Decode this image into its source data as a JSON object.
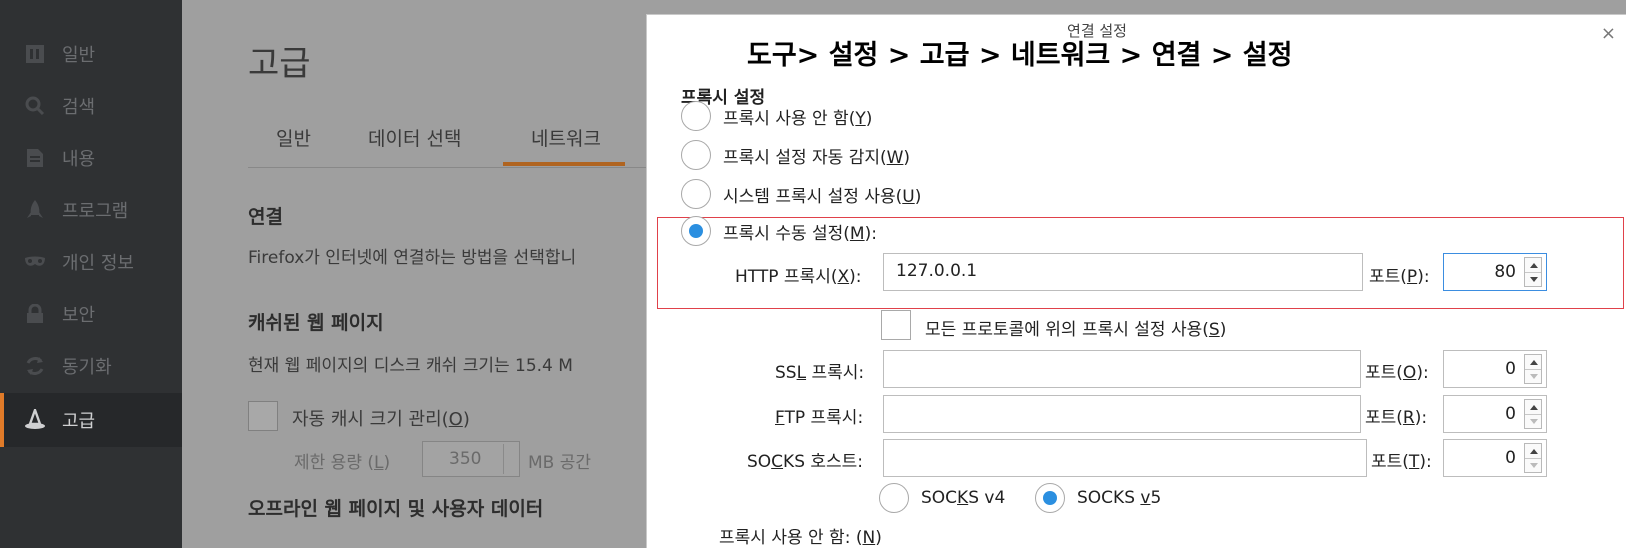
{
  "sidebar": {
    "items": [
      {
        "label": "일반",
        "icon": "general-icon"
      },
      {
        "label": "검색",
        "icon": "search-icon"
      },
      {
        "label": "내용",
        "icon": "document-icon"
      },
      {
        "label": "프로그램",
        "icon": "rocket-icon"
      },
      {
        "label": "개인 정보",
        "icon": "mask-icon"
      },
      {
        "label": "보안",
        "icon": "lock-icon"
      },
      {
        "label": "동기화",
        "icon": "sync-icon"
      },
      {
        "label": "고급",
        "icon": "wizard-hat-icon"
      }
    ],
    "active_index": 7
  },
  "pane": {
    "title": "고급",
    "tabs": [
      "일반",
      "데이터 선택",
      "네트워크"
    ],
    "active_tab": "네트워크",
    "connection_heading": "연결",
    "connection_text": "Firefox가 인터넷에 연결하는 방법을 선택합니",
    "cache_heading": "캐쉬된 웹 페이지",
    "cache_text": "현재 웹 페이지의 디스크 캐쉬 크기는 15.4 M",
    "auto_cache_label": "자동 캐시 크기 관리(",
    "auto_cache_key": "O",
    "limit_label": "제한 용량 (",
    "limit_key": "L",
    "limit_label_end": ")",
    "limit_value": "350",
    "limit_unit": "MB 공간",
    "offline_heading": "오프라인 웹 페이지 및 사용자 데이터"
  },
  "dialog": {
    "title": "연결 설정",
    "close": "×",
    "overlay_breadcrumb": "도구> 설정 > 고급 > 네트워크 > 연결 > 설정",
    "group_label": "프록시 설정",
    "radios": [
      {
        "label": "프록시 사용 안 함(",
        "key": "Y",
        "end": ")",
        "selected": false
      },
      {
        "label": "프록시 설정 자동 감지(",
        "key": "W",
        "end": ")",
        "selected": false
      },
      {
        "label": "시스템 프록시 설정 사용(",
        "key": "U",
        "end": ")",
        "selected": false
      },
      {
        "label": "프록시 수동 설정(",
        "key": "M",
        "end": "):",
        "selected": true
      }
    ],
    "http": {
      "label": "HTTP 프록시(",
      "key": "X",
      "end": "):",
      "value": "127.0.0.1",
      "port_label": "포트(",
      "port_key": "P",
      "port_end": "):",
      "port": "80"
    },
    "share_all": {
      "label": "모든 프로토콜에 위의 프록시 설정 사용(",
      "key": "S",
      "end": ")",
      "checked": false
    },
    "ssl": {
      "label_a": "SS",
      "key": "L",
      "label_b": " 프록시:",
      "value": "",
      "port_label": "포트(",
      "port_key": "O",
      "port_end": "):",
      "port": "0"
    },
    "ftp": {
      "key": "F",
      "label_b": "TP 프록시:",
      "value": "",
      "port_label": "포트(",
      "port_key": "R",
      "port_end": "):",
      "port": "0"
    },
    "socks": {
      "label_a": "SO",
      "key": "C",
      "label_b": "KS 호스트:",
      "value": "",
      "port_label": "포트(",
      "port_key": "T",
      "port_end": "):",
      "port": "0"
    },
    "socks_v4": {
      "label_a": "SOC",
      "key": "K",
      "label_b": "S v4",
      "selected": false
    },
    "socks_v5": {
      "label_a": "SOCKS ",
      "key": "v",
      "label_b": "5",
      "selected": true
    },
    "no_proxy": {
      "label": "프록시 사용 안 함: (",
      "key": "N",
      "end": ")"
    }
  }
}
